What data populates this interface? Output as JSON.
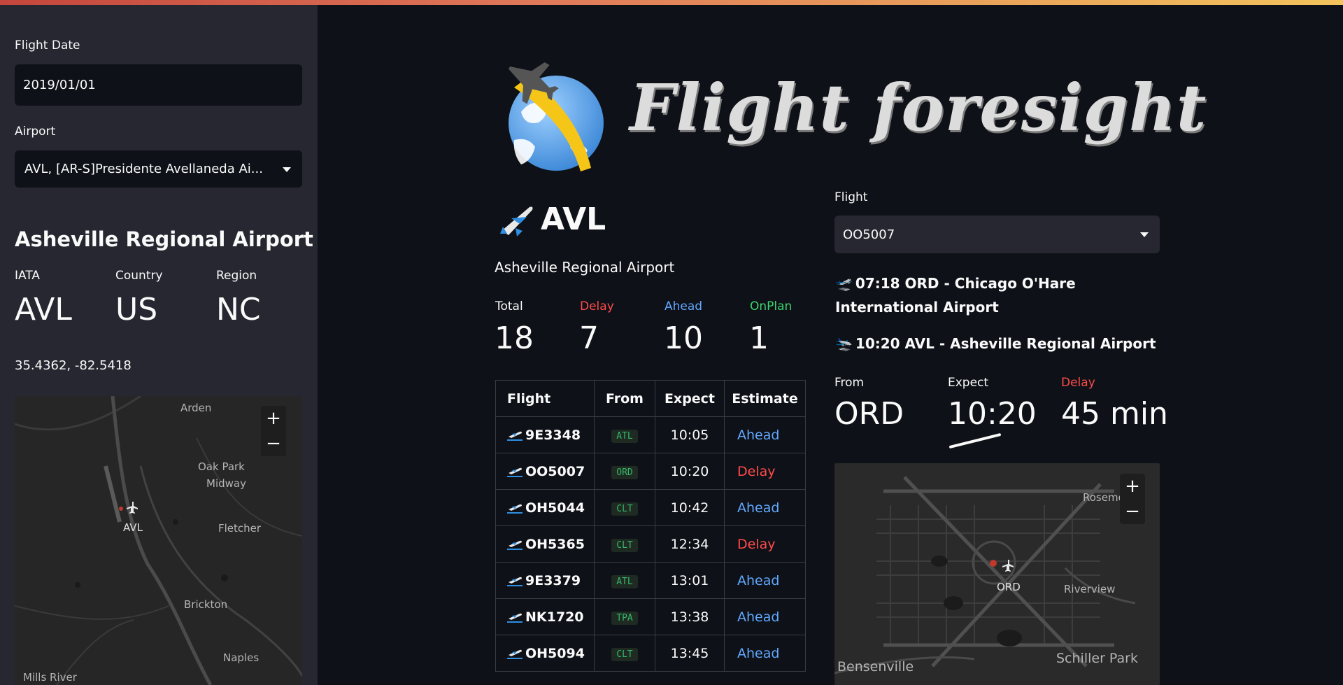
{
  "sidebar": {
    "date_label": "Flight Date",
    "date_value": "2019/01/01",
    "airport_label": "Airport",
    "airport_value": "AVL, [AR-S]Presidente Avellaneda Ai...",
    "airport_name": "Asheville Regional Airport",
    "metrics": [
      {
        "label": "IATA",
        "value": "AVL"
      },
      {
        "label": "Country",
        "value": "US"
      },
      {
        "label": "Region",
        "value": "NC"
      }
    ],
    "coords": "35.4362, -82.5418",
    "map": {
      "labels": [
        "Arden",
        "Oak Park",
        "Midway",
        "Fletcher",
        "AVL",
        "Brickton",
        "Naples",
        "Mills River"
      ],
      "zoom_in": "+",
      "zoom_out": "−"
    }
  },
  "main": {
    "title": "Flight foresight",
    "airport_code": "AVL",
    "airport_name": "Asheville Regional Airport",
    "stats": [
      {
        "label": "Total",
        "value": "18",
        "color": "#fafafa"
      },
      {
        "label": "Delay",
        "value": "7",
        "color": "#ff4b4b"
      },
      {
        "label": "Ahead",
        "value": "10",
        "color": "#61a8ff"
      },
      {
        "label": "OnPlan",
        "value": "1",
        "color": "#3dd56d"
      }
    ],
    "table": {
      "headers": [
        "Flight",
        "From",
        "Expect",
        "Estimate"
      ],
      "rows": [
        {
          "flight": "9E3348",
          "from": "ATL",
          "expect": "10:05",
          "estimate": "Ahead"
        },
        {
          "flight": "OO5007",
          "from": "ORD",
          "expect": "10:20",
          "estimate": "Delay"
        },
        {
          "flight": "OH5044",
          "from": "CLT",
          "expect": "10:42",
          "estimate": "Ahead"
        },
        {
          "flight": "OH5365",
          "from": "CLT",
          "expect": "12:34",
          "estimate": "Delay"
        },
        {
          "flight": "9E3379",
          "from": "ATL",
          "expect": "13:01",
          "estimate": "Ahead"
        },
        {
          "flight": "NK1720",
          "from": "TPA",
          "expect": "13:38",
          "estimate": "Ahead"
        },
        {
          "flight": "OH5094",
          "from": "CLT",
          "expect": "13:45",
          "estimate": "Ahead"
        }
      ]
    }
  },
  "flight_panel": {
    "flight_label": "Flight",
    "flight_value": "OO5007",
    "departure": "07:18 ORD - Chicago O'Hare International Airport",
    "arrival": "10:20 AVL - Asheville Regional Airport",
    "metrics": [
      {
        "label": "From",
        "value": "ORD",
        "color": "#fafafa"
      },
      {
        "label": "Expect",
        "value": "10:20",
        "color": "#fafafa"
      },
      {
        "label": "Delay",
        "value": "45 min",
        "color": "#ff4b4b"
      }
    ],
    "map": {
      "labels": [
        "Rosemont",
        "ORD",
        "Riverview",
        "Bensenville",
        "Schiller Park"
      ],
      "zoom_in": "+",
      "zoom_out": "−"
    }
  },
  "colors": {
    "delay": "#ff4b4b",
    "ahead": "#61a8ff",
    "onplan": "#3dd56d"
  }
}
